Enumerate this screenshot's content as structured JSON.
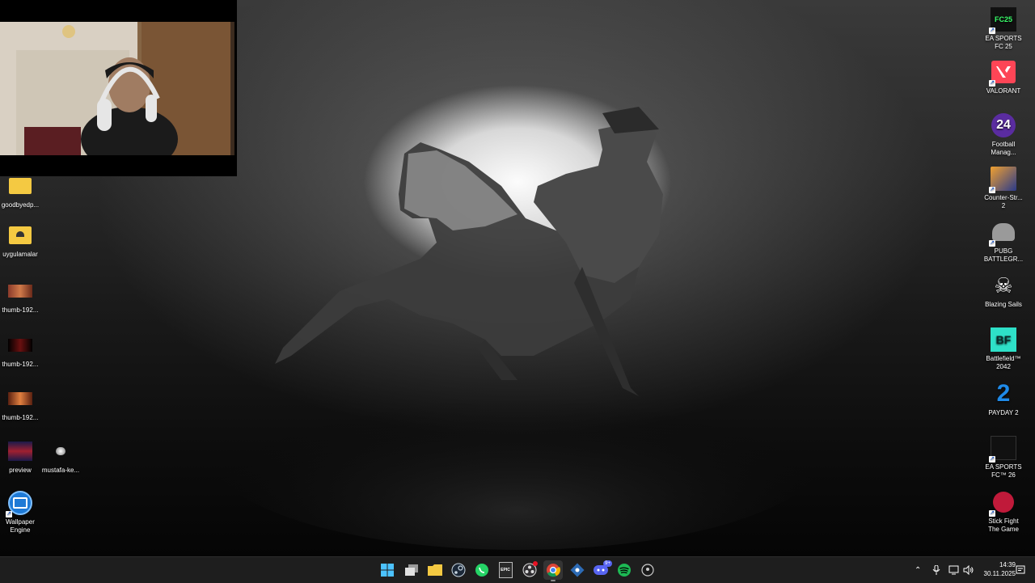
{
  "desktop": {
    "left_icons": [
      {
        "label": "goodbyedp...",
        "icon": "folder-icon"
      },
      {
        "label": "uygulamalar",
        "icon": "folder-icon"
      },
      {
        "label": "thumb-192...",
        "icon": "image-thumbnail-icon"
      },
      {
        "label": "thumb-192...",
        "icon": "image-thumbnail-icon"
      },
      {
        "label": "thumb-192...",
        "icon": "image-thumbnail-icon"
      },
      {
        "label": "preview",
        "icon": "image-thumbnail-icon"
      },
      {
        "label": "mustafa-ke...",
        "icon": "image-thumbnail-icon"
      },
      {
        "label": "Wallpaper\nEngine",
        "icon": "wallpaper-engine-icon"
      }
    ],
    "right_icons": [
      {
        "label": "EA SPORTS\nFC 25",
        "icon": "ea-fc25-icon",
        "badge": "FC25"
      },
      {
        "label": "VALORANT",
        "icon": "valorant-icon",
        "badge": ""
      },
      {
        "label": "Football\nManag...",
        "icon": "football-manager-icon",
        "badge": "24"
      },
      {
        "label": "Counter-Str...\n2",
        "icon": "counter-strike-icon",
        "badge": ""
      },
      {
        "label": "PUBG\nBATTLEGR...",
        "icon": "pubg-icon",
        "badge": ""
      },
      {
        "label": "Blazing Sails",
        "icon": "blazing-sails-icon",
        "badge": ""
      },
      {
        "label": "Battlefield™\n2042",
        "icon": "battlefield-icon",
        "badge": "BF"
      },
      {
        "label": "PAYDAY 2",
        "icon": "payday-icon",
        "badge": "2"
      },
      {
        "label": "EA SPORTS\nFC™ 26",
        "icon": "ea-fc26-icon",
        "badge": ""
      },
      {
        "label": "Stick Fight\nThe Game",
        "icon": "stick-fight-icon",
        "badge": ""
      }
    ]
  },
  "taskbar": {
    "apps": [
      {
        "name": "start",
        "icon": "windows-start-icon"
      },
      {
        "name": "task-view",
        "icon": "task-view-icon"
      },
      {
        "name": "file-explorer",
        "icon": "folder-icon"
      },
      {
        "name": "steam",
        "icon": "steam-icon"
      },
      {
        "name": "whatsapp",
        "icon": "whatsapp-icon"
      },
      {
        "name": "epic-games",
        "icon": "epic-games-icon",
        "text": "EPIC"
      },
      {
        "name": "obs",
        "icon": "obs-icon"
      },
      {
        "name": "chrome",
        "icon": "chrome-icon"
      },
      {
        "name": "snipping",
        "icon": "snip-icon"
      },
      {
        "name": "discord",
        "icon": "discord-icon",
        "badge": "9+"
      },
      {
        "name": "spotify",
        "icon": "spotify-icon"
      },
      {
        "name": "location",
        "icon": "map-pin-icon"
      }
    ],
    "tray": {
      "time": "14:39",
      "date": "30.11.2025"
    }
  },
  "colors": {
    "taskbar_bg": "#1e1e1e",
    "whatsapp": "#25d366",
    "spotify": "#1db954",
    "discord": "#5865f2",
    "windows_blue": "#0a84ff"
  }
}
